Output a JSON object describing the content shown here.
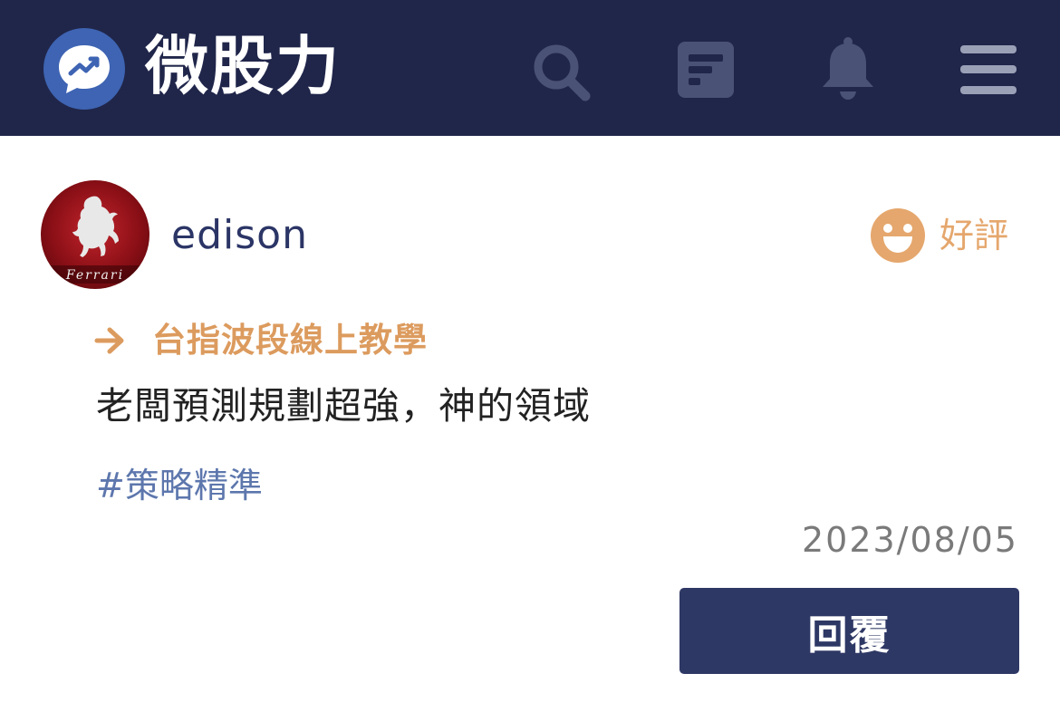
{
  "header": {
    "brand": "微股力",
    "icons": [
      "chart-bubble-logo-icon",
      "search-icon",
      "article-icon",
      "bell-icon",
      "menu-icon"
    ],
    "background_color": "#20264a"
  },
  "review": {
    "username": "edison",
    "avatar_icon": "ferrari-horse-icon",
    "avatar_text": "Ferrari",
    "rating_label": "好評",
    "rating_icon": "smile-face-icon",
    "course_title": "台指波段線上教學",
    "comment": "老闆預測規劃超強，神的領域",
    "tag": "#策略精準",
    "date": "2023/08/05",
    "reply_label": "回覆"
  },
  "colors": {
    "accent_orange": "#dc9b5e",
    "rating_orange": "#e5a76d",
    "tag_blue": "#5d77ad",
    "button_navy": "#2e3865"
  }
}
